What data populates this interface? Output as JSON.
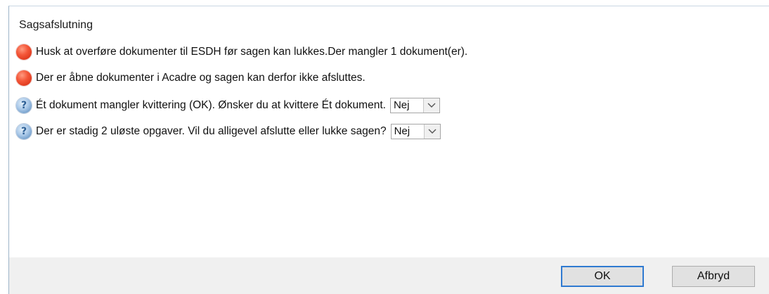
{
  "dialog": {
    "title": "Sagsafslutning"
  },
  "messages": [
    {
      "type": "error",
      "icon": "error-icon",
      "text": "Husk at overføre dokumenter til ESDH før sagen kan lukkes.Der mangler 1 dokument(er)."
    },
    {
      "type": "error",
      "icon": "error-icon",
      "text": "Der er åbne dokumenter i Acadre og sagen kan derfor ikke afsluttes."
    },
    {
      "type": "question",
      "icon": "question-icon",
      "text": "Ét dokument mangler kvittering (OK). Ønsker du at kvittere Ét dokument.",
      "select_value": "Nej"
    },
    {
      "type": "question",
      "icon": "question-icon",
      "text": "Der er stadig 2 uløste opgaver. Vil du alligevel afslutte eller lukke sagen?",
      "select_value": "Nej"
    }
  ],
  "buttons": {
    "ok_label": "OK",
    "cancel_label": "Afbryd"
  },
  "colors": {
    "error": "#e8452a",
    "question": "#6f9bc8",
    "footer_bg": "#f0f0f0",
    "ok_border": "#2f7ad1"
  }
}
